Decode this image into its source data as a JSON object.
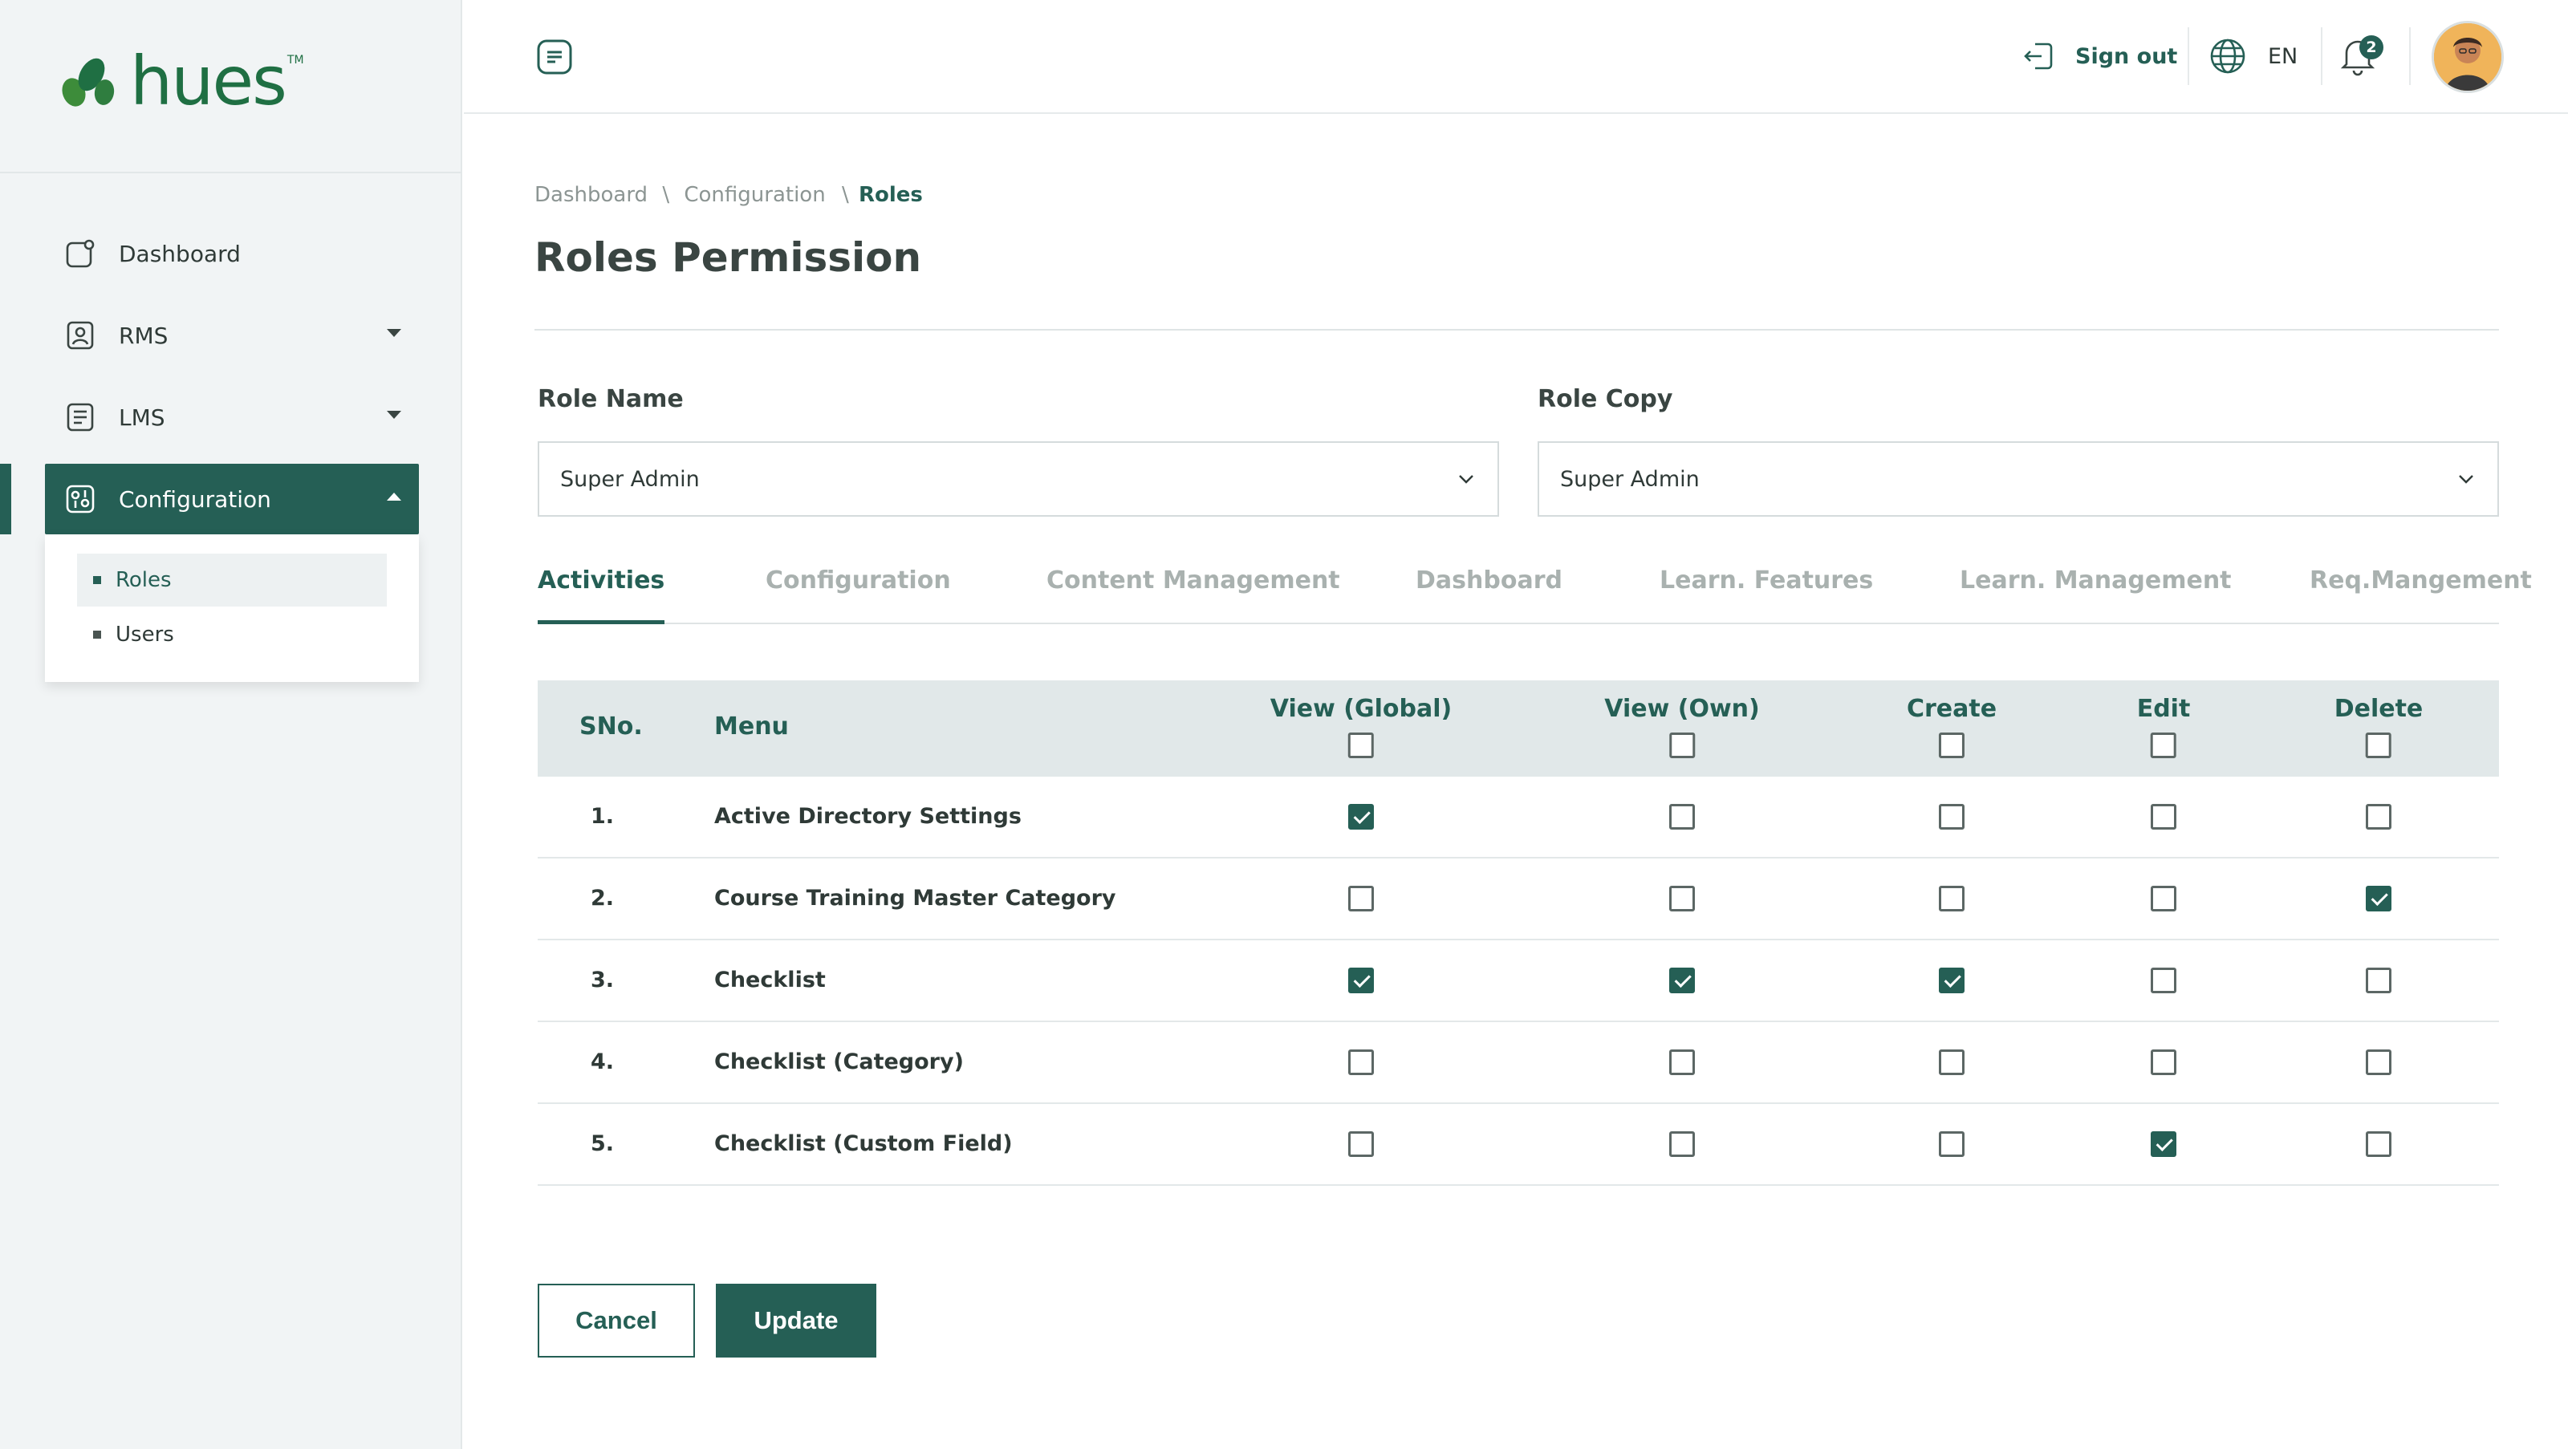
{
  "brand": {
    "name": "hues",
    "tm": "TM"
  },
  "sidebar": {
    "items": [
      {
        "label": "Dashboard",
        "icon": "dashboard-icon"
      },
      {
        "label": "RMS",
        "icon": "user-badge-icon"
      },
      {
        "label": "LMS",
        "icon": "document-list-icon"
      },
      {
        "label": "Configuration",
        "icon": "settings-sliders-icon"
      }
    ],
    "submenu": [
      {
        "label": "Roles"
      },
      {
        "label": "Users"
      }
    ]
  },
  "header": {
    "sign_out": "Sign out",
    "language": "EN",
    "notifications_count": "2"
  },
  "breadcrumb": {
    "items": [
      "Dashboard",
      "Configuration",
      "Roles"
    ],
    "separator": "\\"
  },
  "page": {
    "title": "Roles Permission"
  },
  "form": {
    "role_name_label": "Role Name",
    "role_name_value": "Super Admin",
    "role_copy_label": "Role Copy",
    "role_copy_value": "Super Admin"
  },
  "tabs": [
    "Activities",
    "Configuration",
    "Content Management",
    "Dashboard",
    "Learn. Features",
    "Learn. Management",
    "Req.Mangement"
  ],
  "table": {
    "headers": {
      "sno": "SNo.",
      "menu": "Menu",
      "view_global": "View (Global)",
      "view_own": "View (Own)",
      "create": "Create",
      "edit": "Edit",
      "delete": "Delete"
    },
    "rows": [
      {
        "sno": "1.",
        "menu": "Active Directory Settings",
        "perms": [
          true,
          false,
          false,
          false,
          false
        ]
      },
      {
        "sno": "2.",
        "menu": "Course Training Master Category",
        "perms": [
          false,
          false,
          false,
          false,
          true
        ]
      },
      {
        "sno": "3.",
        "menu": "Checklist",
        "perms": [
          true,
          true,
          true,
          false,
          false
        ]
      },
      {
        "sno": "4.",
        "menu": "Checklist (Category)",
        "perms": [
          false,
          false,
          false,
          false,
          false
        ]
      },
      {
        "sno": "5.",
        "menu": "Checklist (Custom Field)",
        "perms": [
          false,
          false,
          false,
          true,
          false
        ]
      }
    ]
  },
  "actions": {
    "cancel": "Cancel",
    "update": "Update"
  },
  "colors": {
    "primary": "#255f55",
    "brand_green": "#1f6f43",
    "sidebar_bg": "#f1f4f5",
    "table_head_bg": "#e1e8e9"
  }
}
